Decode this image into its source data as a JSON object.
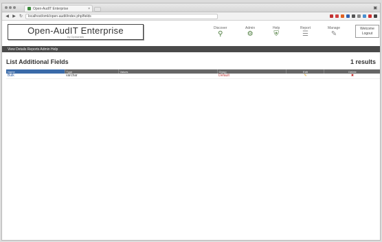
{
  "browser": {
    "tab_title": "Open-AudIT Enterprise",
    "tab_close": "×",
    "url": "localhost/omk/open-audit/index.php/fields",
    "window_control": "▣"
  },
  "header": {
    "logo_text": "Open-AudIT Enterprise",
    "logo_sub": "by Opmantek",
    "icons": [
      {
        "label": "Discover",
        "glyph": "⚲"
      },
      {
        "label": "Admin",
        "glyph": "⚙"
      },
      {
        "label": "Help",
        "glyph": "⛨"
      },
      {
        "label": "Report",
        "glyph": "☰"
      },
      {
        "label": "Manage",
        "glyph": "✎"
      }
    ],
    "logout_line1": "Welcome",
    "logout_line2": "Logout"
  },
  "menubar": {
    "text": "View Details  Reports  Admin  Help"
  },
  "page": {
    "title": "List Additional Fields",
    "results": "1 results"
  },
  "table": {
    "headers": [
      "Name",
      "Type",
      "Values",
      "Group",
      "Edit",
      "Delete"
    ],
    "rows": [
      {
        "name": "Bulk",
        "type": "varchar",
        "values": "",
        "group": "Default",
        "edit": "✎",
        "delete": "✖"
      }
    ]
  },
  "colors": {
    "menu_bg": "#4a4a4a",
    "header_bg": "#666666",
    "sorted_header": "#3a6aa8",
    "accent_green": "#6a9a3a"
  }
}
